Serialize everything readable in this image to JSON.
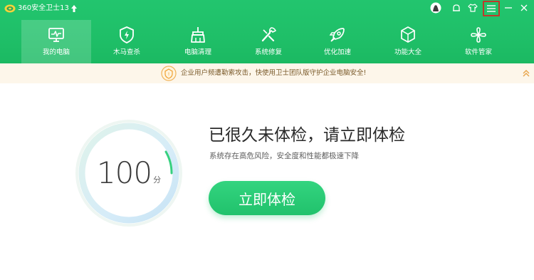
{
  "app": {
    "title": "360安全卫士13"
  },
  "window_controls": [
    "avatar",
    "notification",
    "skin",
    "main-menu",
    "minimize",
    "close"
  ],
  "nav": {
    "active": "我的电脑",
    "tabs": [
      {
        "label": "我的电脑",
        "icon": "monitor-icon"
      },
      {
        "label": "木马查杀",
        "icon": "shield-icon"
      },
      {
        "label": "电脑清理",
        "icon": "broom-icon"
      },
      {
        "label": "系统修复",
        "icon": "wrench-icon"
      },
      {
        "label": "优化加速",
        "icon": "rocket-icon"
      },
      {
        "label": "功能大全",
        "icon": "cube-icon"
      },
      {
        "label": "软件管家",
        "icon": "flower-icon"
      }
    ]
  },
  "notice": {
    "text": "企业用户频遭勒索攻击，快使用卫士团队版守护企业电脑安全!"
  },
  "main": {
    "score": "100",
    "score_unit": "分",
    "headline": "已很久未体检，请立即体检",
    "subline": "系统存在高危风险，安全度和性能都极速下降",
    "button_label": "立即体检"
  },
  "colors": {
    "brand_green": "#1fbf68",
    "notice_bg": "#fdf6ea",
    "notice_accent": "#f0b35a",
    "menu_highlight": "#c0392b"
  }
}
